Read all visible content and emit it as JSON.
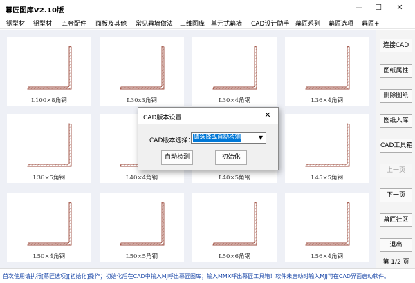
{
  "window": {
    "title": "幕匠图库V2.10版",
    "minimize_glyph": "—",
    "maximize_glyph": "☐",
    "close_glyph": "✕"
  },
  "menu": [
    "钢型材",
    "铝型材",
    "五金配件",
    "面板及其他",
    "常见幕墙做法",
    "三维图库",
    "单元式幕墙",
    "CAD设计助手",
    "幕匠系列",
    "幕匠选项",
    "幕匠+"
  ],
  "gallery": {
    "items": [
      {
        "label": "L100×8角钢"
      },
      {
        "label": "L30x3角钢"
      },
      {
        "label": "L30×4角钢"
      },
      {
        "label": "L36×4角钢"
      },
      {
        "label": "L36×5角钢"
      },
      {
        "label": "L40×4角钢"
      },
      {
        "label": "L40×5角钢"
      },
      {
        "label": "L45×5角钢"
      },
      {
        "label": "L50×4角钢"
      },
      {
        "label": "L50×5角钢"
      },
      {
        "label": "L50×6角钢"
      },
      {
        "label": "L56×4角钢"
      }
    ]
  },
  "sidebar": {
    "buttons": [
      {
        "label": "连接CAD",
        "enabled": true
      },
      {
        "label": "图纸属性",
        "enabled": true
      },
      {
        "label": "删除图纸",
        "enabled": true
      },
      {
        "label": "图纸入库",
        "enabled": true
      },
      {
        "label": "CAD工具箱",
        "enabled": true
      },
      {
        "label": "上一页",
        "enabled": false
      },
      {
        "label": "下一页",
        "enabled": true
      },
      {
        "label": "幕匠社区",
        "enabled": true
      },
      {
        "label": "退出",
        "enabled": true
      }
    ],
    "page_indicator": "第 1/2 页"
  },
  "status": {
    "text": "首次使用请执行[幕匠选项][初始化]操作；初始化后在CAD中输入MJ呼出幕匠图库；输入MMX呼出幕匠工具箱！软件未启动时输入MJJ可在CAD界面启动软件。"
  },
  "dialog": {
    "title": "CAD版本设置",
    "close_glyph": "✕",
    "version_label": "CAD版本选择：",
    "version_value": "请选择或自动检测",
    "dropdown_glyph": "▼",
    "auto_detect_label": "自动检测",
    "init_label": "初始化"
  },
  "colors": {
    "gallery_bg": "#eef0f6",
    "profile_stroke": "#9b4a3c",
    "hatch": "#b5776a",
    "status_text": "#1a47a8",
    "selection": "#0078d7"
  }
}
